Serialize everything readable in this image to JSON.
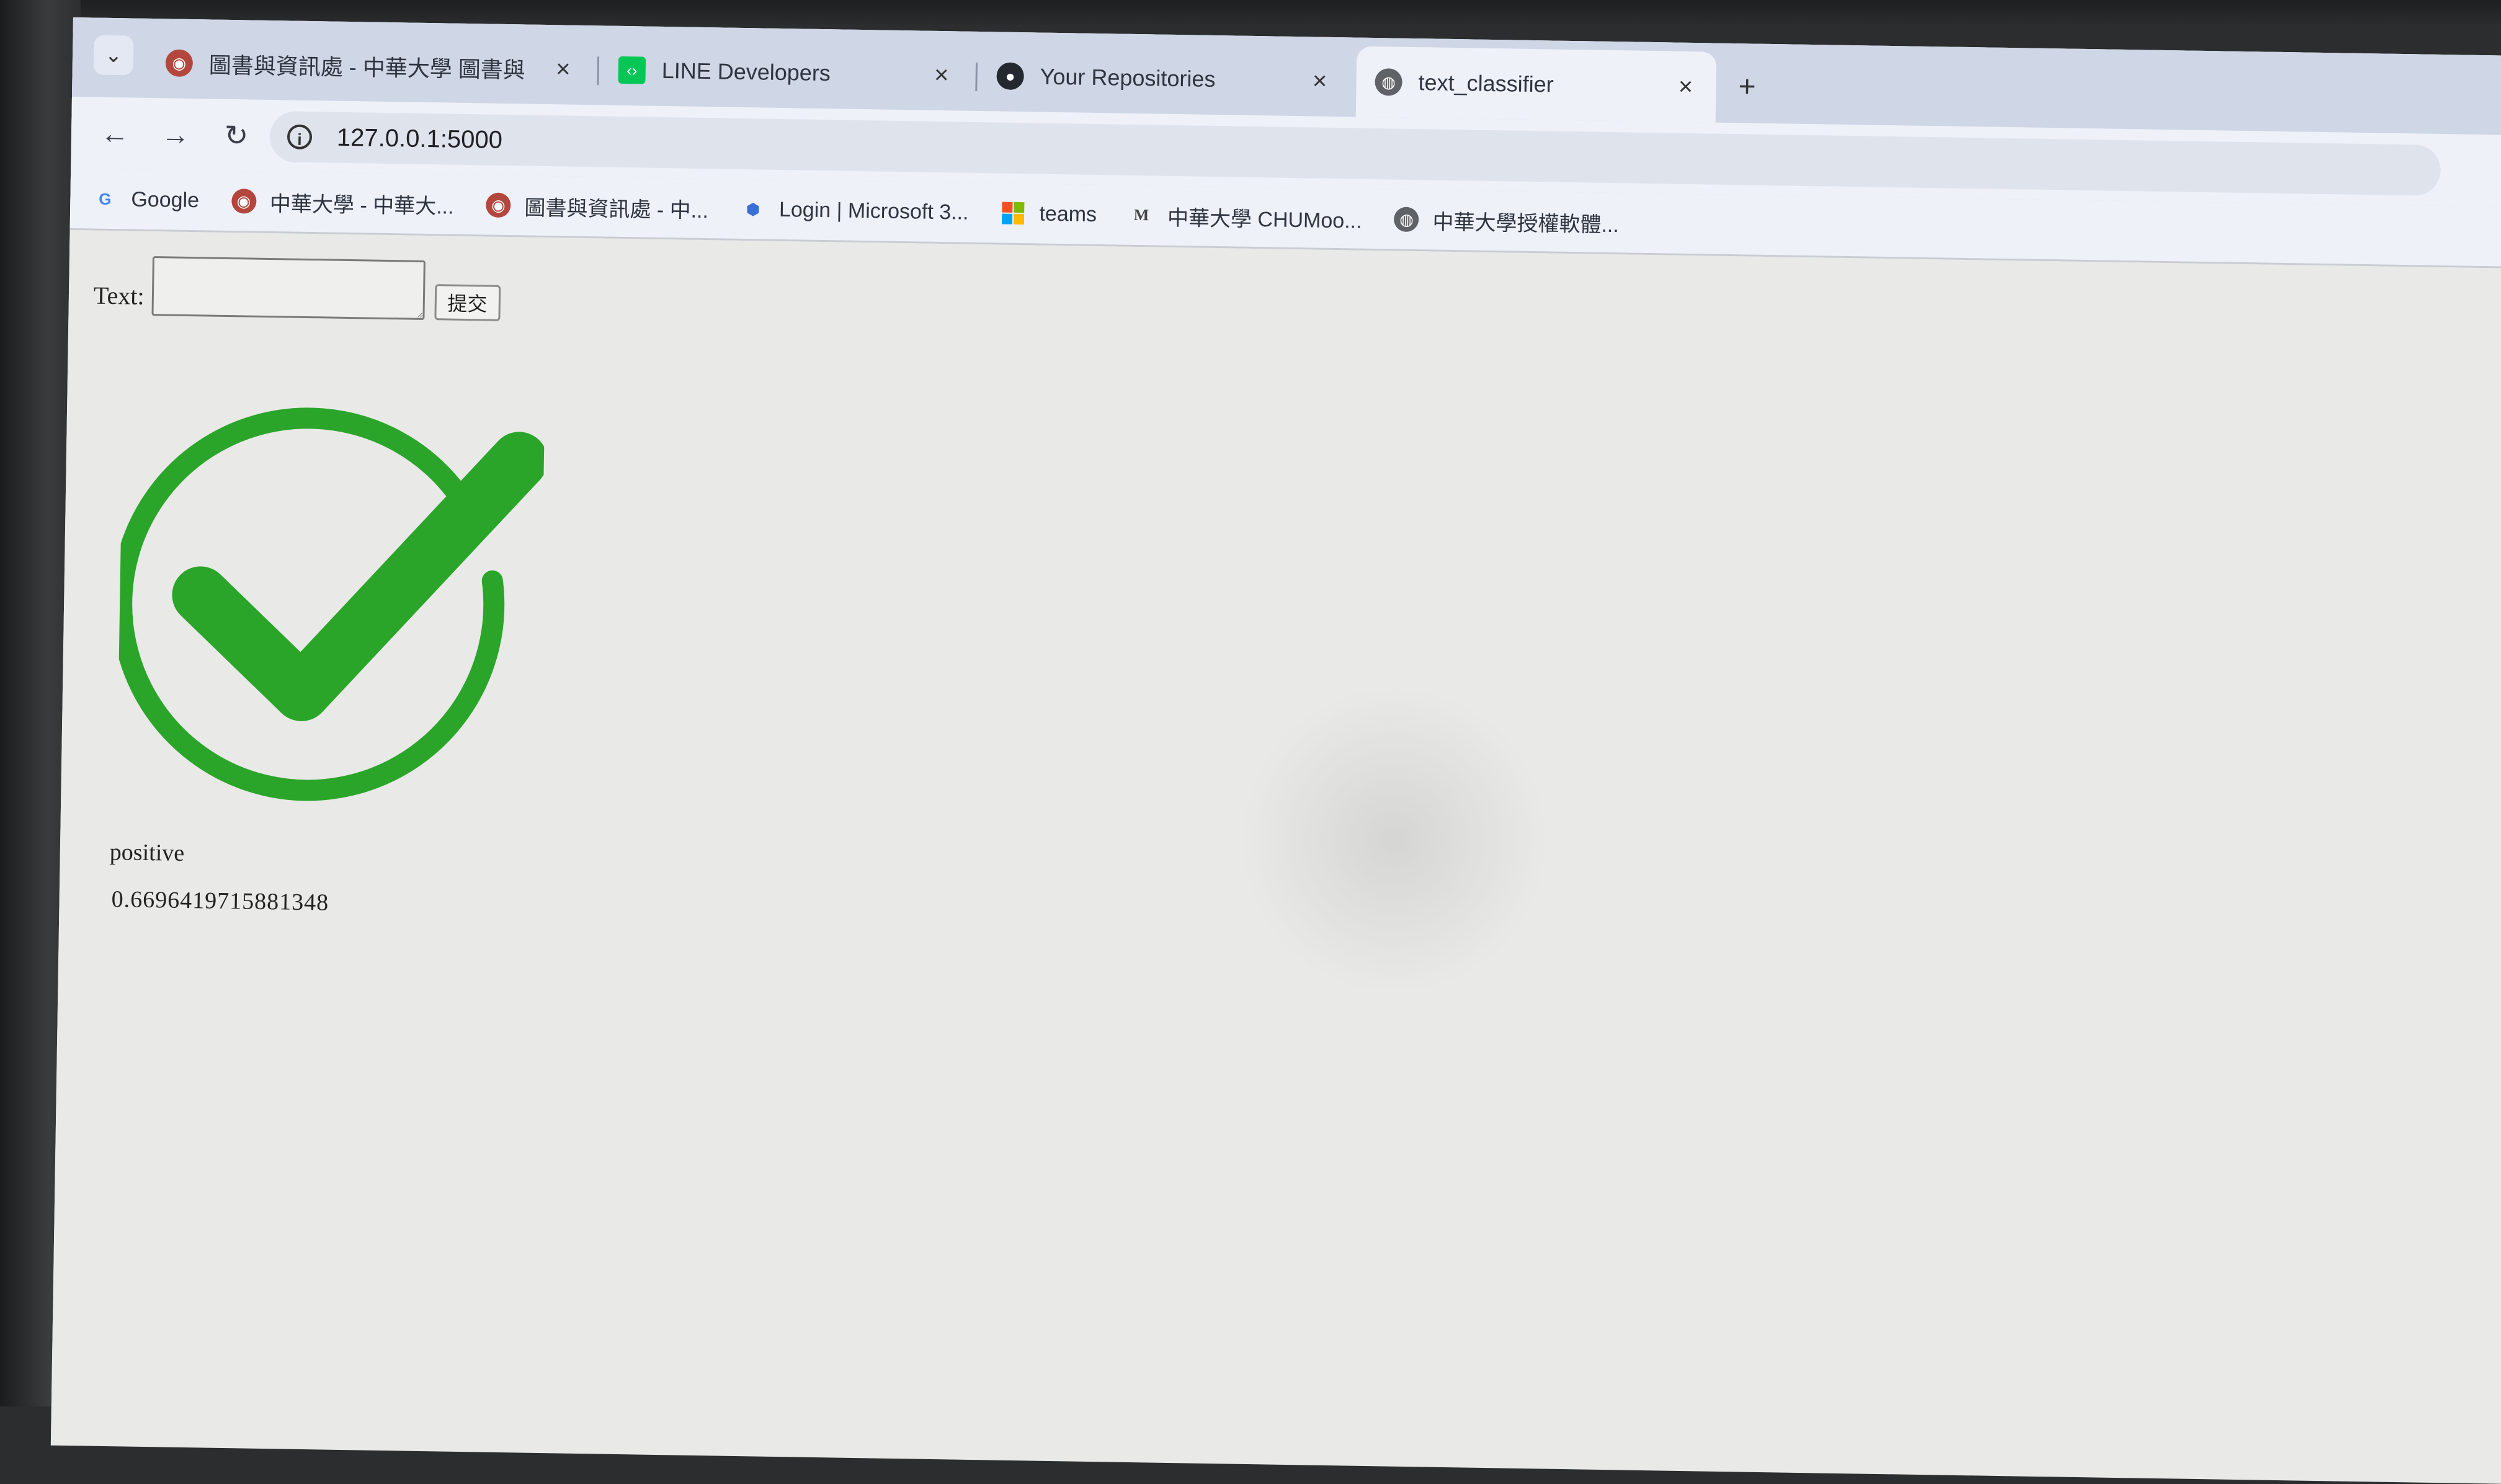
{
  "browser": {
    "tabs": [
      {
        "title": "圖書與資訊處 - 中華大學 圖書與",
        "favicon": "chu-logo-icon",
        "active": false
      },
      {
        "title": "LINE Developers",
        "favicon": "line-developers-icon",
        "active": false
      },
      {
        "title": "Your Repositories",
        "favicon": "github-icon",
        "active": false
      },
      {
        "title": "text_classifier",
        "favicon": "globe-icon",
        "active": true
      }
    ],
    "new_tab_label": "+",
    "close_label": "×",
    "address_bar": {
      "url": "127.0.0.1:5000"
    },
    "bookmarks": [
      {
        "label": "Google",
        "icon": "google-icon"
      },
      {
        "label": "中華大學 - 中華大...",
        "icon": "chu-logo-icon"
      },
      {
        "label": "圖書與資訊處 - 中...",
        "icon": "chu-logo-icon"
      },
      {
        "label": "Login | Microsoft 3...",
        "icon": "microsoft-login-icon"
      },
      {
        "label": "teams",
        "icon": "microsoft-icon"
      },
      {
        "label": "中華大學 CHUMoo...",
        "icon": "moodle-icon"
      },
      {
        "label": "中華大學授權軟體...",
        "icon": "globe-icon"
      }
    ]
  },
  "form": {
    "label": "Text:",
    "input_value": "",
    "submit_label": "提交"
  },
  "result": {
    "icon": "green-checkmark-icon",
    "icon_color": "#2aa52a",
    "label": "positive",
    "score": "0.6696419715881348"
  }
}
